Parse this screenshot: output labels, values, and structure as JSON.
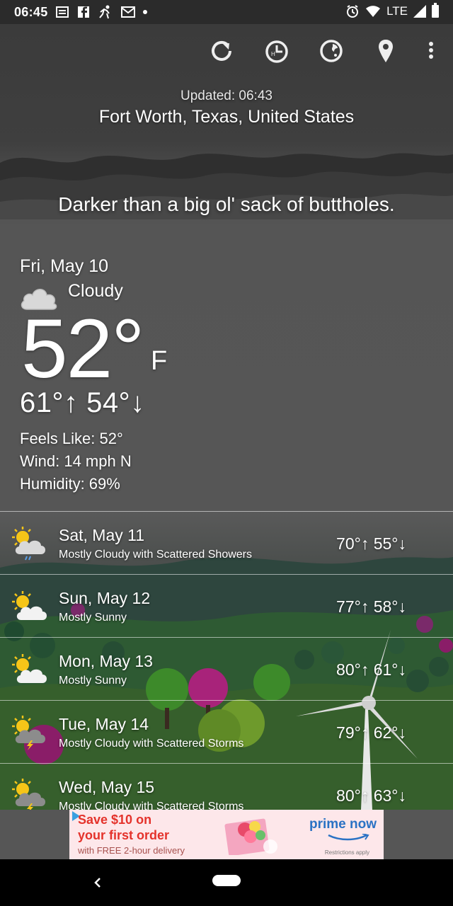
{
  "status_bar": {
    "time": "06:45",
    "network": "LTE",
    "left_icons": [
      "news-icon",
      "facebook-icon",
      "fitness-icon",
      "gmail-icon",
      "dot-icon"
    ],
    "right_icons": [
      "alarm-icon",
      "wifi-icon",
      "signal-icon",
      "battery-icon"
    ]
  },
  "toolbar": {
    "icons": [
      "refresh-icon",
      "history-icon",
      "radar-icon",
      "location-pin-icon",
      "more-vert-icon"
    ]
  },
  "header": {
    "updated": "Updated: 06:43",
    "location": "Fort Worth, Texas, United States"
  },
  "headline": "Darker than a big ol' sack of buttholes.",
  "current": {
    "date": "Fri, May 10",
    "condition": "Cloudy",
    "condition_icon": "cloud-icon",
    "temp": "52°",
    "unit": "F",
    "hilo": "61°↑ 54°↓",
    "feels_like": "Feels Like: 52°",
    "wind": "Wind: 14 mph N",
    "humidity": "Humidity: 69%"
  },
  "forecast": [
    {
      "day": "Sat, May 11",
      "desc": "Mostly Cloudy with Scattered Showers",
      "temps": "70°↑ 55°↓",
      "icon": "sun-cloud-rain-icon"
    },
    {
      "day": "Sun, May 12",
      "desc": "Mostly Sunny",
      "temps": "77°↑ 58°↓",
      "icon": "sun-cloud-icon"
    },
    {
      "day": "Mon, May 13",
      "desc": "Mostly Sunny",
      "temps": "80°↑ 61°↓",
      "icon": "sun-cloud-icon"
    },
    {
      "day": "Tue, May 14",
      "desc": "Mostly Cloudy with Scattered Storms",
      "temps": "79°↑ 62°↓",
      "icon": "sun-cloud-storm-icon"
    },
    {
      "day": "Wed, May 15",
      "desc": "Mostly Cloudy with Scattered Storms",
      "temps": "80°↑ 63°↓",
      "icon": "sun-cloud-storm-icon"
    }
  ],
  "ad": {
    "line1": "Save $10 on",
    "line2": "your first order",
    "line3": "with FREE 2-hour delivery",
    "brand": "prime now",
    "fine_print": "Restrictions apply"
  },
  "colors": {
    "ad_text": "#e4322b",
    "brand_blue": "#2a72c4",
    "sun": "#f5c518"
  }
}
